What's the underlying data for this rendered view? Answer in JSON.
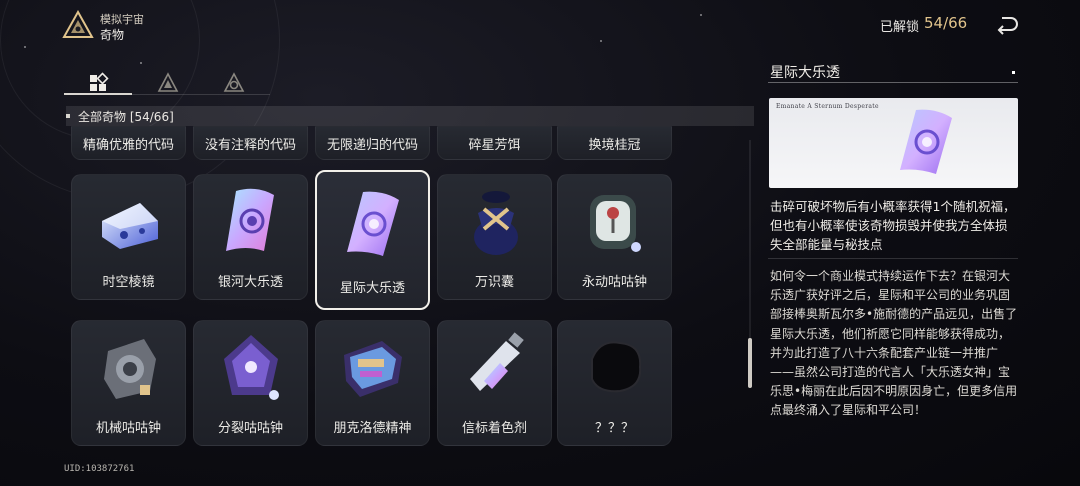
{
  "header": {
    "subtitle": "模拟宇宙",
    "title": "奇物",
    "unlock_label": "已解锁",
    "unlock_count": "54/66"
  },
  "tabs": [
    {
      "name": "all",
      "icon": "grid-icon",
      "active": true
    },
    {
      "name": "category-2",
      "icon": "triangle-emblem-icon",
      "active": false
    },
    {
      "name": "category-3",
      "icon": "triangle-emblem-alt-icon",
      "active": false
    }
  ],
  "section": {
    "label": "全部奇物 [54/66]"
  },
  "grid": {
    "row0": [
      "精确优雅的代码",
      "没有注释的代码",
      "无限递归的代码",
      "碎星芳饵",
      "换境桂冠"
    ],
    "row1": [
      "时空棱镜",
      "银河大乐透",
      "星际大乐透",
      "万识囊",
      "永动咕咕钟"
    ],
    "row2": [
      "机械咕咕钟",
      "分裂咕咕钟",
      "朋克洛德精神",
      "信标着色剂",
      "？？？"
    ],
    "selected": "星际大乐透"
  },
  "detail": {
    "title": "星际大乐透",
    "preview_caption": "Emanate A Sternum Desperate",
    "effect": "击碎可破坏物后有小概率获得1个随机祝福，但也有小概率使该奇物损毁并使我方全体损失全部能量与秘技点",
    "lore": "如何令一个商业模式持续运作下去？在银河大乐透广获好评之后，星际和平公司的业务巩固部接棒奥斯瓦尔多•施耐德的产品远见，出售了星际大乐透，他们祈愿它同样能够获得成功，并为此打造了八十六条配套产业链一并推广——虽然公司打造的代言人「大乐透女神」宝乐思•梅丽在此后因不明原因身亡，但更多信用点最终涌入了星际和平公司！"
  },
  "footer": {
    "uid": "UID:103872761"
  },
  "colors": {
    "accent_gold": "#e1c48c",
    "card_bg": "#272a32",
    "selected_border": "#f2f0ea"
  }
}
